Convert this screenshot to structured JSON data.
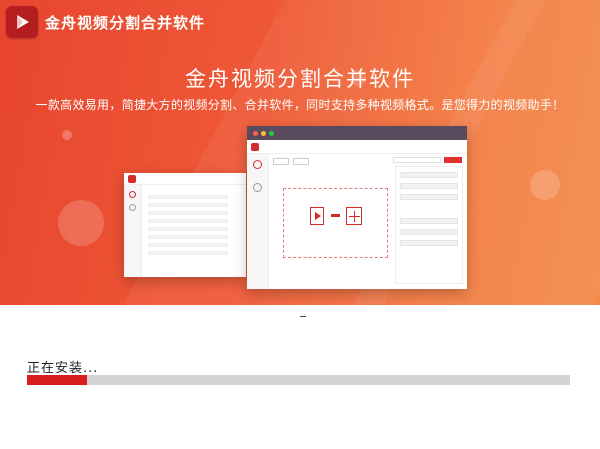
{
  "app": {
    "title": "金舟视频分割合并软件",
    "logo_icon": "play-icon",
    "logo_color": "#b51e1e"
  },
  "banner": {
    "headline": "金舟视频分割合并软件",
    "subline": "一款高效易用，简捷大方的视频分割、合并软件，同时支持多种视频格式。是您得力的视频助手！",
    "gradient_start": "#e8452f",
    "gradient_end": "#f38a48"
  },
  "install": {
    "status": "正在安装...",
    "progress": 0.11,
    "progress_color": "#d71d1d",
    "track_color": "#d4d4d4"
  }
}
